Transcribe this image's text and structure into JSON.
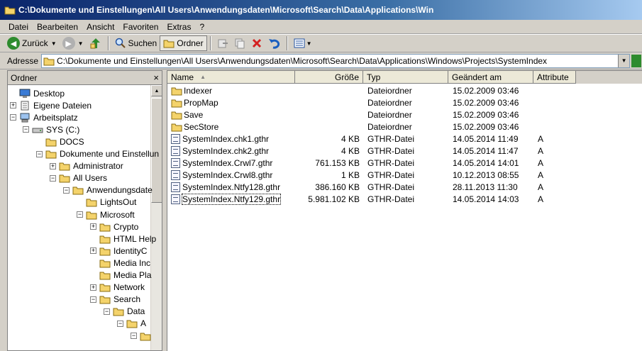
{
  "window": {
    "title": "C:\\Dokumente und Einstellungen\\All Users\\Anwendungsdaten\\Microsoft\\Search\\Data\\Applications\\Win"
  },
  "menu": [
    "Datei",
    "Bearbeiten",
    "Ansicht",
    "Favoriten",
    "Extras",
    "?"
  ],
  "toolbar": {
    "back_label": "Zurück",
    "search_label": "Suchen",
    "folders_label": "Ordner"
  },
  "address": {
    "label": "Adresse",
    "value": "C:\\Dokumente und Einstellungen\\All Users\\Anwendungsdaten\\Microsoft\\Search\\Data\\Applications\\Windows\\Projects\\SystemIndex"
  },
  "tree": {
    "header": "Ordner",
    "close": "×",
    "items": [
      {
        "label": "Desktop",
        "icon": "desktop-icon",
        "expander": ""
      },
      {
        "label": "Eigene Dateien",
        "icon": "documents-icon",
        "expander": "+"
      },
      {
        "label": "Arbeitsplatz",
        "icon": "computer-icon",
        "expander": "−"
      },
      {
        "label": "SYS (C:)",
        "icon": "drive-icon",
        "expander": "−"
      },
      {
        "label": "DOCS",
        "icon": "folder-icon",
        "expander": ""
      },
      {
        "label": "Dokumente und Einstellun",
        "icon": "folder-icon",
        "expander": "−"
      },
      {
        "label": "Administrator",
        "icon": "folder-icon",
        "expander": "+"
      },
      {
        "label": "All Users",
        "icon": "folder-icon",
        "expander": "−"
      },
      {
        "label": "Anwendungsdate",
        "icon": "folder-icon",
        "expander": "−"
      },
      {
        "label": "LightsOut",
        "icon": "folder-icon",
        "expander": ""
      },
      {
        "label": "Microsoft",
        "icon": "folder-icon",
        "expander": "−"
      },
      {
        "label": "Crypto",
        "icon": "folder-icon",
        "expander": "+"
      },
      {
        "label": "HTML Help",
        "icon": "folder-icon",
        "expander": ""
      },
      {
        "label": "IdentityC",
        "icon": "folder-icon",
        "expander": "+"
      },
      {
        "label": "Media Inc",
        "icon": "folder-icon",
        "expander": ""
      },
      {
        "label": "Media Pla",
        "icon": "folder-icon",
        "expander": ""
      },
      {
        "label": "Network",
        "icon": "folder-icon",
        "expander": "+"
      },
      {
        "label": "Search",
        "icon": "folder-icon",
        "expander": "−"
      },
      {
        "label": "Data",
        "icon": "folder-icon",
        "expander": "−"
      },
      {
        "label": "A",
        "icon": "folder-icon",
        "expander": "−"
      },
      {
        "label": "",
        "icon": "folder-icon",
        "expander": "−"
      }
    ]
  },
  "list": {
    "columns": [
      "Name",
      "Größe",
      "Typ",
      "Geändert am",
      "Attribute"
    ],
    "rows": [
      {
        "name": "Indexer",
        "size": "",
        "type": "Dateiordner",
        "modified": "15.02.2009 03:46",
        "attr": "",
        "kind": "folder"
      },
      {
        "name": "PropMap",
        "size": "",
        "type": "Dateiordner",
        "modified": "15.02.2009 03:46",
        "attr": "",
        "kind": "folder"
      },
      {
        "name": "Save",
        "size": "",
        "type": "Dateiordner",
        "modified": "15.02.2009 03:46",
        "attr": "",
        "kind": "folder"
      },
      {
        "name": "SecStore",
        "size": "",
        "type": "Dateiordner",
        "modified": "15.02.2009 03:46",
        "attr": "",
        "kind": "folder"
      },
      {
        "name": "SystemIndex.chk1.gthr",
        "size": "4 KB",
        "type": "GTHR-Datei",
        "modified": "14.05.2014 11:49",
        "attr": "A",
        "kind": "file"
      },
      {
        "name": "SystemIndex.chk2.gthr",
        "size": "4 KB",
        "type": "GTHR-Datei",
        "modified": "14.05.2014 11:47",
        "attr": "A",
        "kind": "file"
      },
      {
        "name": "SystemIndex.Crwl7.gthr",
        "size": "761.153 KB",
        "type": "GTHR-Datei",
        "modified": "14.05.2014 14:01",
        "attr": "A",
        "kind": "file"
      },
      {
        "name": "SystemIndex.Crwl8.gthr",
        "size": "1 KB",
        "type": "GTHR-Datei",
        "modified": "10.12.2013 08:55",
        "attr": "A",
        "kind": "file"
      },
      {
        "name": "SystemIndex.Ntfy128.gthr",
        "size": "386.160 KB",
        "type": "GTHR-Datei",
        "modified": "28.11.2013 11:30",
        "attr": "A",
        "kind": "file"
      },
      {
        "name": "SystemIndex.Ntfy129.gthr",
        "size": "5.981.102 KB",
        "type": "GTHR-Datei",
        "modified": "14.05.2014 14:03",
        "attr": "A",
        "kind": "file"
      }
    ]
  },
  "colors": {
    "title_start": "#0a246a",
    "title_end": "#a6caf0",
    "folder_yellow": "#f4d36b",
    "delete_red": "#d42020",
    "back_green": "#2e8b2e"
  }
}
